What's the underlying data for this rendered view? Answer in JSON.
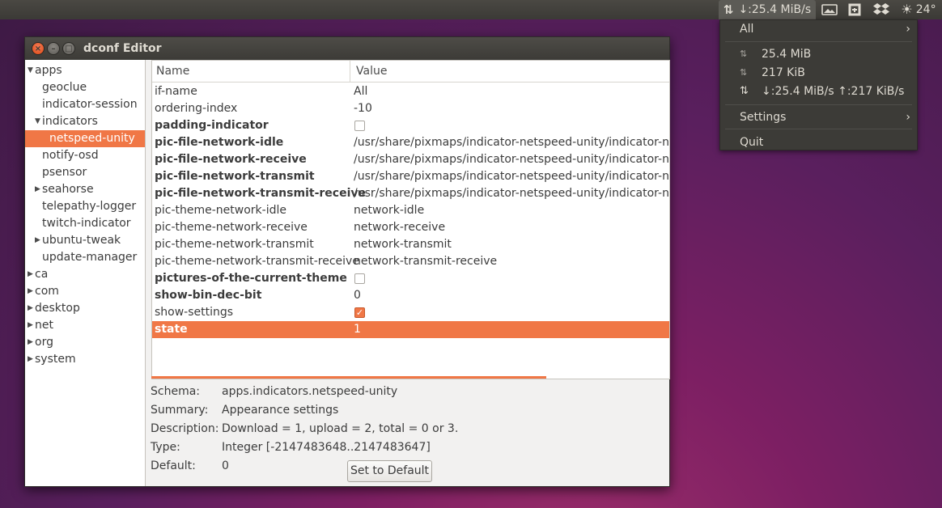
{
  "top_panel": {
    "netspeed": "↓:25.4 MiB/s",
    "weather_temp": "24°"
  },
  "netspeed_menu": {
    "all_label": "All",
    "download_total": "25.4 MiB",
    "upload_total": "217 KiB",
    "combined": "↓:25.4 MiB/s ↑:217 KiB/s",
    "settings_label": "Settings",
    "quit_label": "Quit"
  },
  "window": {
    "title": "dconf Editor"
  },
  "tree": {
    "items": [
      {
        "label": "apps",
        "level": 0,
        "expander": "down"
      },
      {
        "label": "geoclue",
        "level": 1,
        "expander": "none"
      },
      {
        "label": "indicator-session",
        "level": 1,
        "expander": "none"
      },
      {
        "label": "indicators",
        "level": 1,
        "expander": "down"
      },
      {
        "label": "netspeed-unity",
        "level": 2,
        "expander": "none",
        "selected": true
      },
      {
        "label": "notify-osd",
        "level": 1,
        "expander": "none"
      },
      {
        "label": "psensor",
        "level": 1,
        "expander": "none"
      },
      {
        "label": "seahorse",
        "level": 1,
        "expander": "right"
      },
      {
        "label": "telepathy-logger",
        "level": 1,
        "expander": "none"
      },
      {
        "label": "twitch-indicator",
        "level": 1,
        "expander": "none"
      },
      {
        "label": "ubuntu-tweak",
        "level": 1,
        "expander": "right"
      },
      {
        "label": "update-manager",
        "level": 1,
        "expander": "none"
      },
      {
        "label": "ca",
        "level": 0,
        "expander": "right"
      },
      {
        "label": "com",
        "level": 0,
        "expander": "right"
      },
      {
        "label": "desktop",
        "level": 0,
        "expander": "right"
      },
      {
        "label": "net",
        "level": 0,
        "expander": "right"
      },
      {
        "label": "org",
        "level": 0,
        "expander": "right"
      },
      {
        "label": "system",
        "level": 0,
        "expander": "right"
      }
    ]
  },
  "table": {
    "columns": [
      "Name",
      "Value"
    ],
    "rows": [
      {
        "name": "if-name",
        "value": "All",
        "bold": false
      },
      {
        "name": "ordering-index",
        "value": "-10",
        "bold": false
      },
      {
        "name": "padding-indicator",
        "value": "",
        "bold": true,
        "checkbox": "unchecked"
      },
      {
        "name": "pic-file-network-idle",
        "value": "/usr/share/pixmaps/indicator-netspeed-unity/indicator-ne",
        "bold": true
      },
      {
        "name": "pic-file-network-receive",
        "value": "/usr/share/pixmaps/indicator-netspeed-unity/indicator-ne",
        "bold": true
      },
      {
        "name": "pic-file-network-transmit",
        "value": "/usr/share/pixmaps/indicator-netspeed-unity/indicator-ne",
        "bold": true
      },
      {
        "name": "pic-file-network-transmit-receive",
        "value": "/usr/share/pixmaps/indicator-netspeed-unity/indicator-ne",
        "bold": true
      },
      {
        "name": "pic-theme-network-idle",
        "value": "network-idle",
        "bold": false
      },
      {
        "name": "pic-theme-network-receive",
        "value": "network-receive",
        "bold": false
      },
      {
        "name": "pic-theme-network-transmit",
        "value": "network-transmit",
        "bold": false
      },
      {
        "name": "pic-theme-network-transmit-receive",
        "value": "network-transmit-receive",
        "bold": false
      },
      {
        "name": "pictures-of-the-current-theme",
        "value": "",
        "bold": true,
        "checkbox": "unchecked"
      },
      {
        "name": "show-bin-dec-bit",
        "value": "0",
        "bold": true
      },
      {
        "name": "show-settings",
        "value": "",
        "bold": false,
        "checkbox": "checked"
      },
      {
        "name": "state",
        "value": "1",
        "bold": true,
        "selected": true
      }
    ]
  },
  "details": {
    "schema_label": "Schema:",
    "schema_value": "apps.indicators.netspeed-unity",
    "summary_label": "Summary:",
    "summary_value": "Appearance settings",
    "description_label": "Description:",
    "description_value": "Download = 1, upload = 2, total = 0 or 3.",
    "type_label": "Type:",
    "type_value": "Integer [-2147483648..2147483647]",
    "default_label": "Default:",
    "default_value": "0",
    "set_default_label": "Set to Default"
  },
  "colors": {
    "accent": "#f07746",
    "panel": "#3c3b37"
  }
}
